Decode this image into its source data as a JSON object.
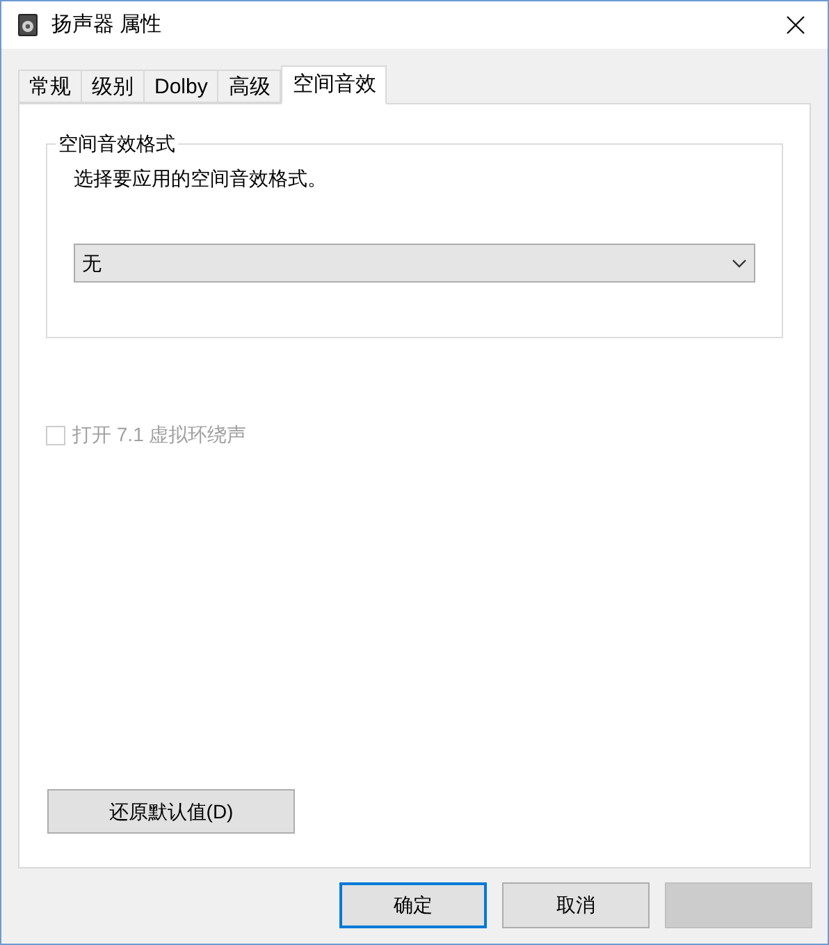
{
  "window": {
    "title": "扬声器 属性"
  },
  "tabs": [
    {
      "label": "常规",
      "selected": false
    },
    {
      "label": "级别",
      "selected": false
    },
    {
      "label": "Dolby",
      "selected": false
    },
    {
      "label": "高级",
      "selected": false
    },
    {
      "label": "空间音效",
      "selected": true
    }
  ],
  "format_group": {
    "title": "空间音效格式",
    "description": "选择要应用的空间音效格式。",
    "dropdown": {
      "value": "无"
    }
  },
  "virtual_surround": {
    "label": "打开 7.1 虚拟环绕声",
    "checked": false,
    "disabled": true
  },
  "restore_button": {
    "label": "还原默认值(D)"
  },
  "buttons": [
    {
      "kind": "default",
      "label": "确定",
      "disabled": false
    },
    {
      "kind": "normal",
      "label": "取消",
      "disabled": false
    },
    {
      "kind": "hidden",
      "disabled": true
    }
  ]
}
